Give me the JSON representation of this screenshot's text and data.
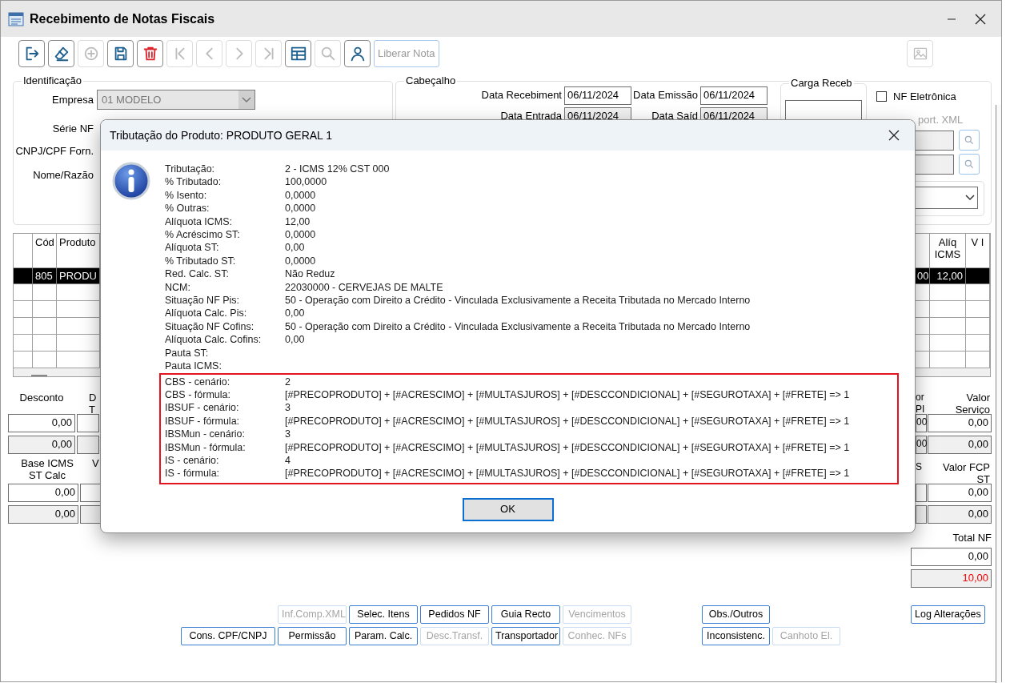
{
  "window": {
    "title": "Recebimento de Notas Fiscais"
  },
  "toolbar": {
    "buttons": [
      {
        "kind": "exit",
        "disabled": false
      },
      {
        "kind": "eraser",
        "disabled": false
      },
      {
        "kind": "add",
        "disabled": true
      },
      {
        "kind": "save",
        "disabled": false
      },
      {
        "kind": "delete",
        "disabled": false
      },
      {
        "kind": "first",
        "disabled": true
      },
      {
        "kind": "previous",
        "disabled": true
      },
      {
        "kind": "next",
        "disabled": true
      },
      {
        "kind": "last",
        "disabled": true
      },
      {
        "kind": "table",
        "disabled": false
      },
      {
        "kind": "search",
        "disabled": true
      },
      {
        "kind": "user",
        "disabled": false
      }
    ],
    "release_button": {
      "label": "Liberar Nota",
      "disabled": true
    },
    "image_button": {
      "disabled": true
    }
  },
  "identificacao": {
    "title": "Identificação",
    "empresa": {
      "label": "Empresa",
      "value": "01 MODELO",
      "disabled": true
    },
    "labels": [
      "Série NF",
      "CNPJ/CPF Forn.",
      "Nome/Razão"
    ]
  },
  "cabecalho": {
    "title": "Cabeçalho",
    "dates": [
      {
        "label": "Data Recebiment",
        "value": "06/11/2024"
      },
      {
        "label": "Data Emissão",
        "value": "06/11/2024"
      },
      {
        "label": "Data Entrada",
        "value": "06/11/2024"
      },
      {
        "label": "Data Saíd",
        "value": "06/11/2024"
      }
    ],
    "carga_receb": {
      "title": "Carga Receb"
    },
    "nf_eletronica": {
      "label": "NF Eletrônica",
      "checked": false
    },
    "import_xml": {
      "label": "port. XML",
      "disabled": true
    }
  },
  "grid": {
    "left_columns": [
      "Cód",
      "Produto"
    ],
    "right_columns": [
      "Alíq ICMS",
      "V I"
    ],
    "rows": [
      {
        "selected": true,
        "left_cells": [
          "805",
          "PRODU"
        ],
        "right_cells": [
          "00",
          "12,00"
        ]
      }
    ]
  },
  "totals_left": [
    {
      "label": "Desconto",
      "fragment": "D T",
      "values": [
        "0,00",
        "0,00"
      ]
    },
    {
      "label": "Base ICMS ST Calc",
      "fragment": "V",
      "values": [
        "0,00",
        "0,00"
      ]
    }
  ],
  "totals_right": [
    {
      "fragment": "or PI",
      "fragment_values": [
        "00",
        "00"
      ],
      "label": "Valor Serviço",
      "values": [
        "0,00",
        "0,00"
      ]
    },
    {
      "fragment": "S",
      "label": "Valor FCP ST",
      "values": [
        "0,00",
        "0,00"
      ]
    }
  ],
  "total_nf": {
    "label": "Total NF",
    "values": [
      {
        "text": "0,00",
        "alert": false
      },
      {
        "text": "10,00",
        "alert": true
      }
    ]
  },
  "bottom_buttons": {
    "left": [
      [
        {
          "label": "Inf.Comp.XML",
          "disabled": true
        },
        {
          "label": "Selec. Itens",
          "disabled": false
        },
        {
          "label": "Pedidos NF",
          "disabled": false
        },
        {
          "label": "Guia Recto",
          "disabled": false
        },
        {
          "label": "Vencimentos",
          "disabled": true
        }
      ],
      [
        {
          "label": "Cons. CPF/CNPJ",
          "disabled": false
        },
        {
          "label": "Permissão",
          "disabled": false
        },
        {
          "label": "Param. Calc.",
          "disabled": false
        },
        {
          "label": "Desc.Transf.",
          "disabled": true
        },
        {
          "label": "Transportador",
          "disabled": false
        },
        {
          "label": "Conhec. NFs",
          "disabled": true
        }
      ]
    ],
    "middle": [
      [
        {
          "label": "Obs./Outros",
          "disabled": false
        }
      ],
      [
        {
          "label": "Inconsistenc.",
          "disabled": false
        },
        {
          "label": "Canhoto El.",
          "disabled": true
        }
      ]
    ],
    "right": [
      {
        "label": "Log Alterações",
        "disabled": false
      }
    ]
  },
  "dialog": {
    "title": "Tributação do Produto: PRODUTO GERAL 1",
    "rows": [
      {
        "label": "Tributação:",
        "value": "2 - ICMS 12% CST 000"
      },
      {
        "label": "% Tributado:",
        "value": "100,0000"
      },
      {
        "label": "% Isento:",
        "value": "0,0000"
      },
      {
        "label": "% Outras:",
        "value": "0,0000"
      },
      {
        "label": "Alíquota ICMS:",
        "value": "12,00"
      },
      {
        "label": "% Acréscimo ST:",
        "value": "0,0000"
      },
      {
        "label": "Alíquota ST:",
        "value": "0,00"
      },
      {
        "label": "% Tributado ST:",
        "value": "0,0000"
      },
      {
        "label": "Red. Calc. ST:",
        "value": "Não Reduz"
      },
      {
        "label": "NCM:",
        "value": "22030000 - CERVEJAS DE MALTE"
      },
      {
        "label": "Situação NF Pis:",
        "value": "50 - Operação com Direito a Crédito - Vinculada Exclusivamente a Receita Tributada no Mercado Interno"
      },
      {
        "label": "Alíquota Calc. Pis:",
        "value": "0,00"
      },
      {
        "label": "Situação NF Cofins:",
        "value": "50 - Operação com Direito a Crédito - Vinculada Exclusivamente a Receita Tributada no Mercado Interno"
      },
      {
        "label": "Alíquota Calc. Cofins:",
        "value": "0,00"
      },
      {
        "label": "Pauta ST:"
      },
      {
        "label": "Pauta ICMS:"
      }
    ],
    "highlighted_rows": [
      {
        "label": "CBS - cenário:",
        "value": "2"
      },
      {
        "label": "CBS - fórmula:",
        "value": "[#PRECOPRODUTO] + [#ACRESCIMO] + [#MULTASJUROS] + [#DESCCONDICIONAL] + [#SEGUROTAXA] + [#FRETE] => 1"
      },
      {
        "label": "IBSUF - cenário:",
        "value": "3"
      },
      {
        "label": "IBSUF - fórmula:",
        "value": "[#PRECOPRODUTO] + [#ACRESCIMO] + [#MULTASJUROS] + [#DESCCONDICIONAL] + [#SEGUROTAXA] + [#FRETE] => 1"
      },
      {
        "label": "IBSMun - cenário:",
        "value": "3"
      },
      {
        "label": "IBSMun - fórmula:",
        "value": "[#PRECOPRODUTO] + [#ACRESCIMO] + [#MULTASJUROS] + [#DESCCONDICIONAL] + [#SEGUROTAXA] + [#FRETE] => 1"
      },
      {
        "label": "IS - cenário:",
        "value": "4"
      },
      {
        "label": "IS - fórmula:",
        "value": "[#PRECOPRODUTO] + [#ACRESCIMO] + [#MULTASJUROS] + [#DESCCONDICIONAL] + [#SEGUROTAXA] + [#FRETE] => 1"
      }
    ],
    "ok_button": "OK"
  }
}
